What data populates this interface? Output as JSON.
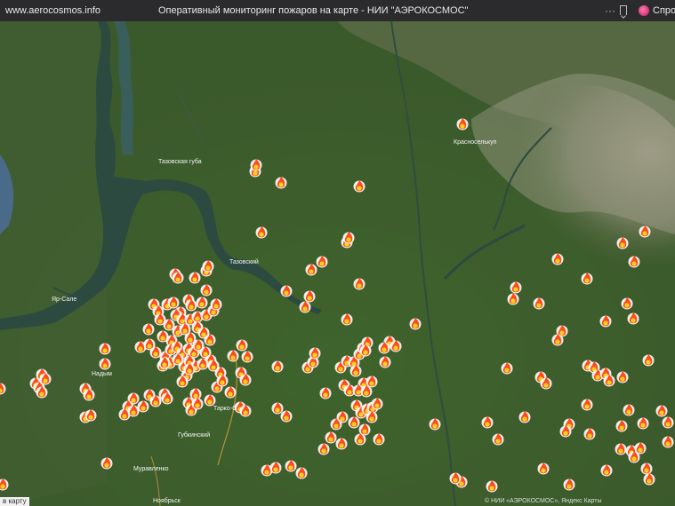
{
  "browser": {
    "domain": "www.aerocosmos.info",
    "title": "Оперативный мониторинг пожаров на карте - НИИ \"АЭРОКОСМОС\"",
    "menu_icon": "more-dots-icon",
    "bookmark_icon": "bookmark-icon",
    "ask_label": "Спрос"
  },
  "map": {
    "place_labels": [
      "Тазовская губа",
      "Тазовский",
      "Красноселькуп",
      "Яр-Сале",
      "Надым",
      "Губкинский",
      "Тарко-Сале",
      "Муравленко",
      "Ноябрьск"
    ],
    "fire_count": 212,
    "marker_icon": "fire-icon",
    "colors": {
      "fire_outer": "#ff4a1c",
      "fire_inner": "#ffd21e",
      "fire_ring": "#ffffff",
      "land": "#3f5c2e",
      "water": "#2c4a40"
    }
  },
  "footer": {
    "left_text": "в карту",
    "right_text": "© НИИ «АЭРОКОСМОС», Яндекс Карты"
  }
}
